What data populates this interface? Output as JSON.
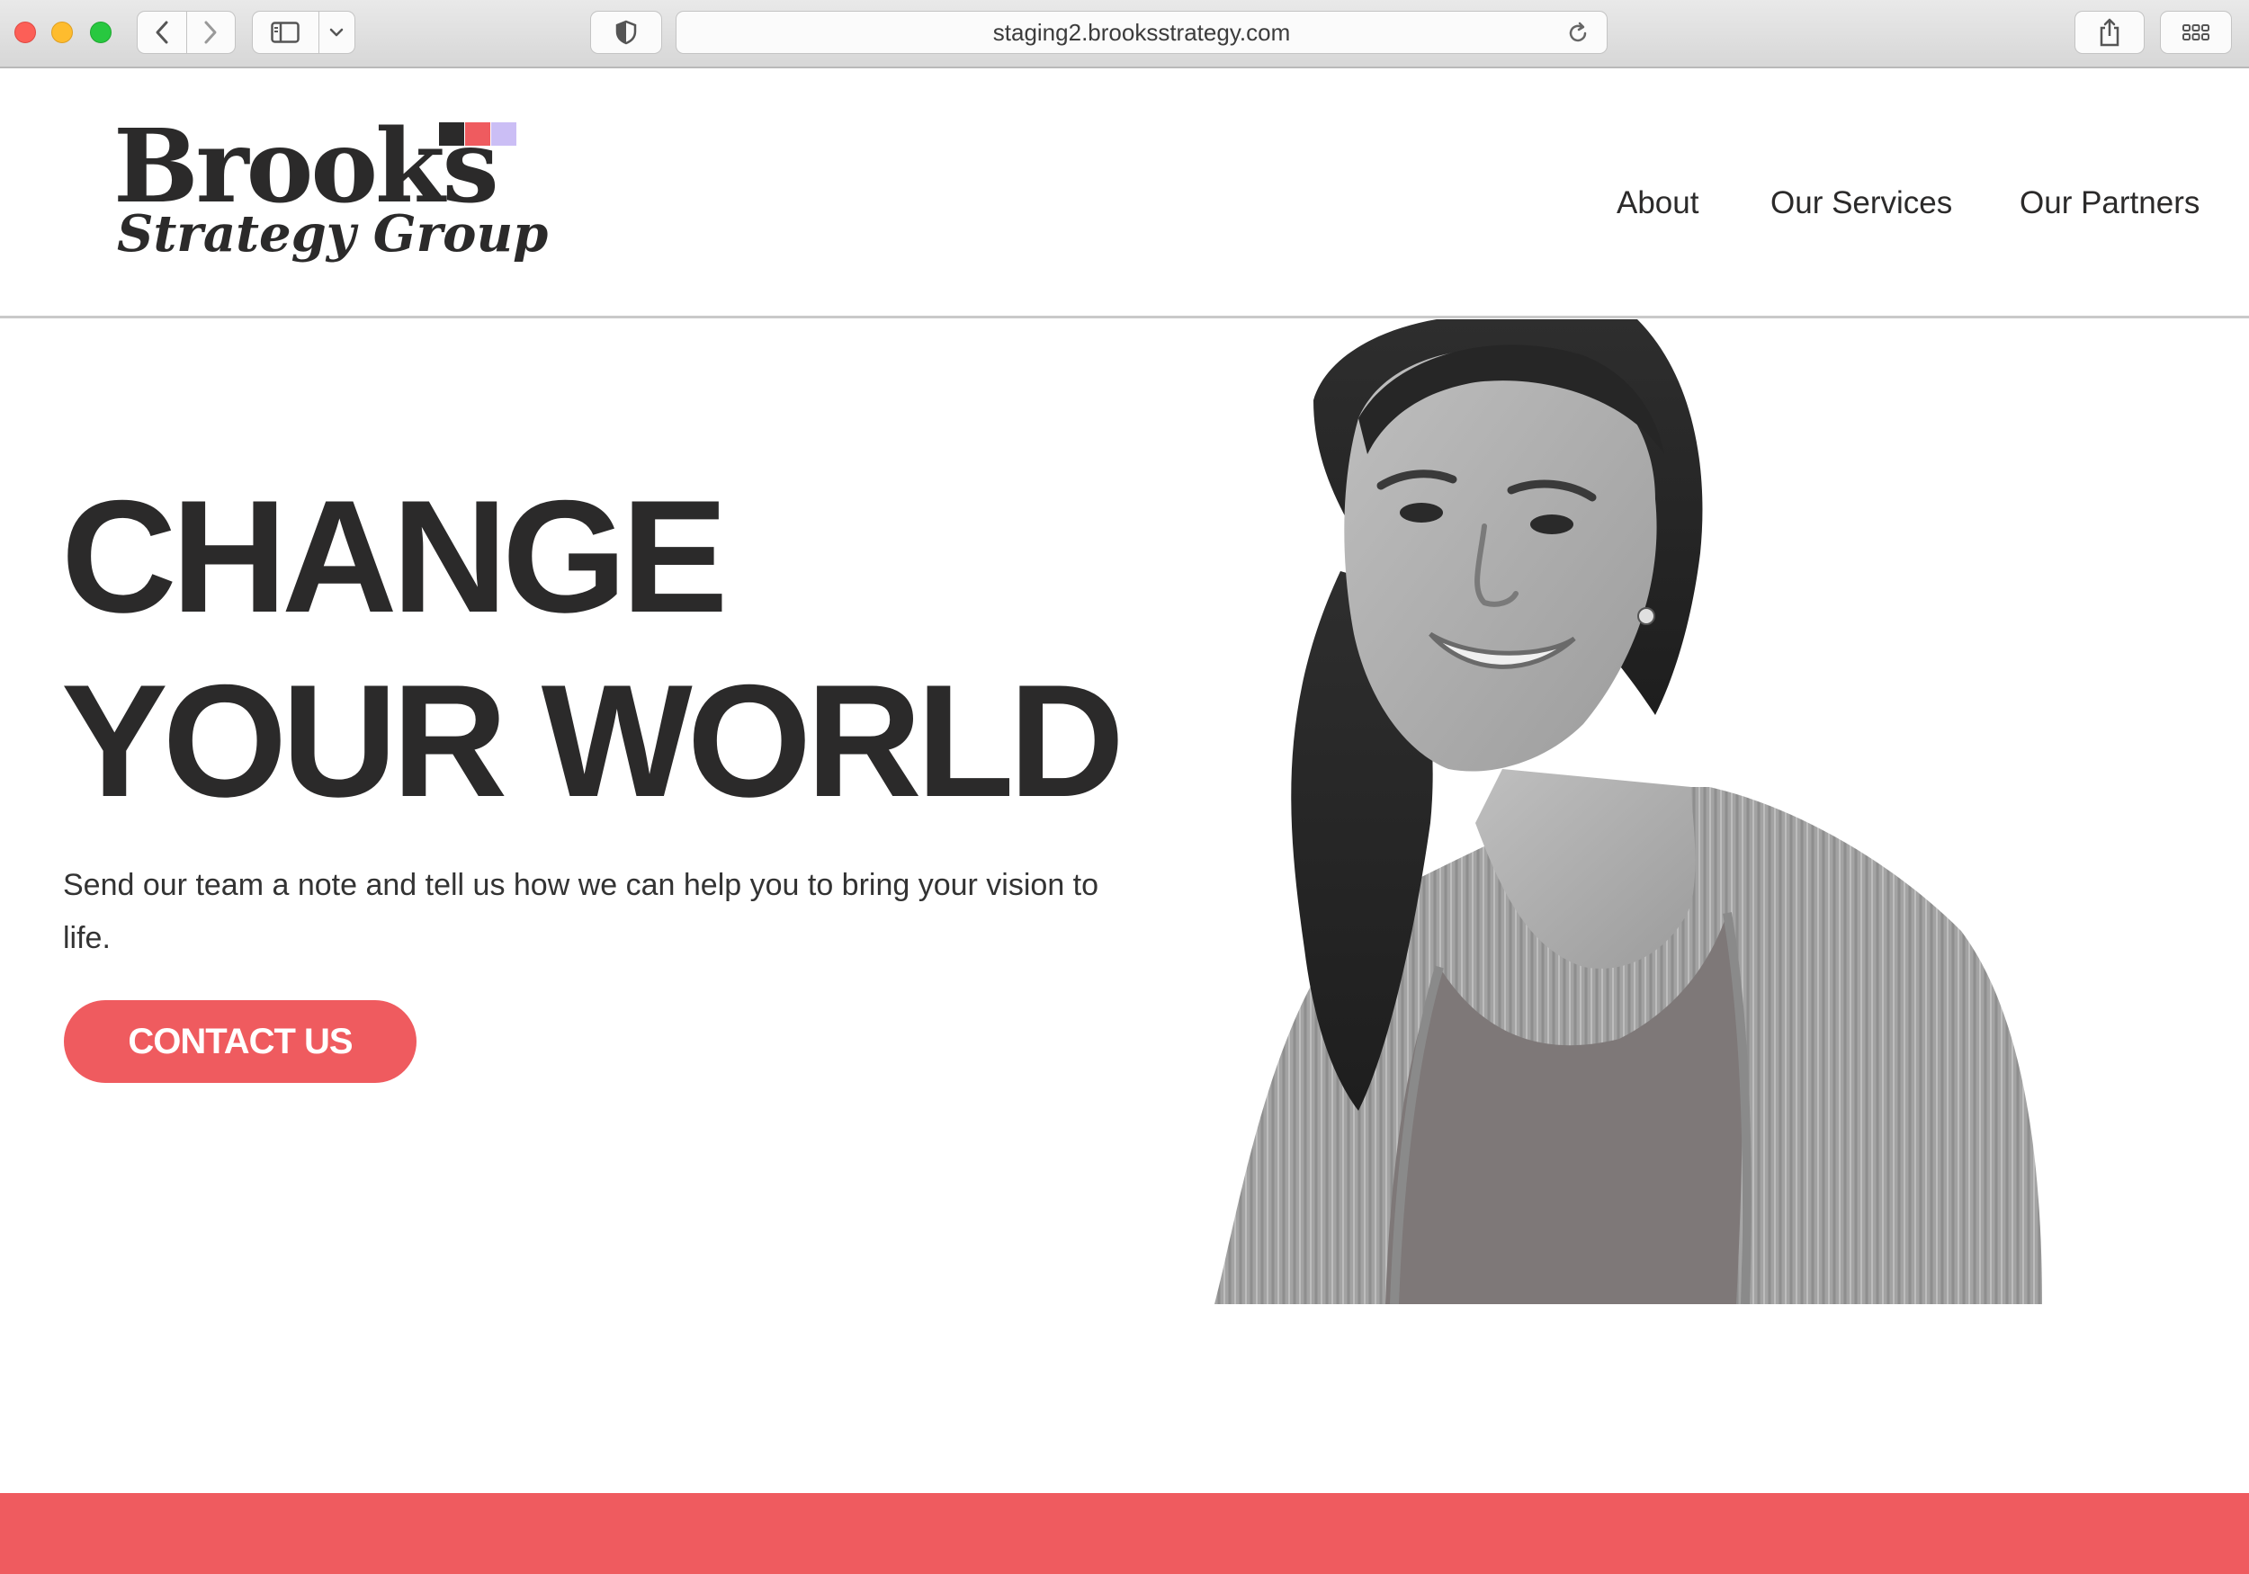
{
  "browser": {
    "url": "staging2.brooksstrategy.com"
  },
  "logo": {
    "name": "Brooks",
    "tagline": "Strategy Group",
    "square_colors": [
      "#2b2a2a",
      "#ef5b5f",
      "#cbbef5"
    ]
  },
  "nav": {
    "items": [
      {
        "label": "About"
      },
      {
        "label": "Our Services"
      },
      {
        "label": "Our Partners"
      }
    ]
  },
  "hero": {
    "title_line1": "CHANGE",
    "title_line2": "YOUR WORLD",
    "description": "Send our team a note and tell us how we can help you to bring your vision to life.",
    "cta_label": "CONTACT US"
  },
  "colors": {
    "accent": "#ef5b5f",
    "text": "#2b2a2a",
    "lavender": "#cbbef5"
  }
}
